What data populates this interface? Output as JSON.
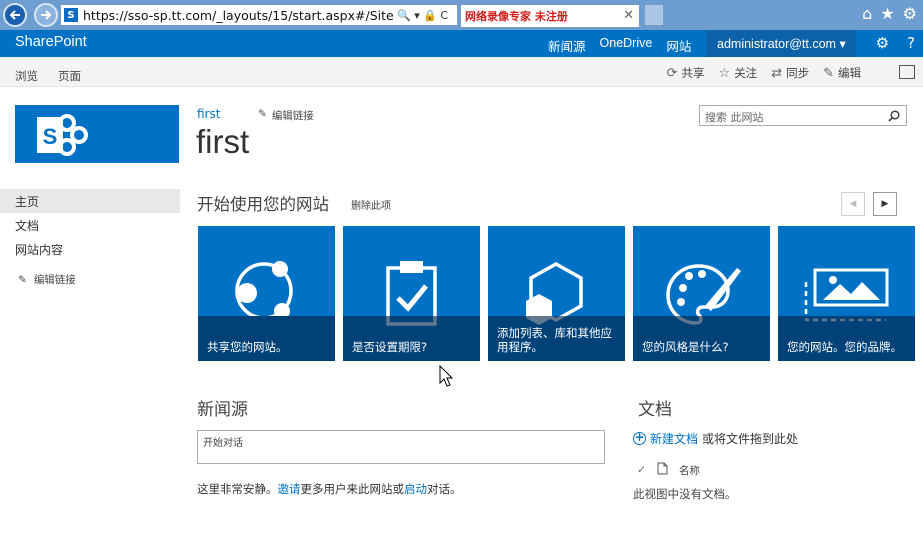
{
  "browser": {
    "address": "https://sso-sp.tt.com/_layouts/15/start.aspx#/SitePages/%E",
    "address_icons": "🔍 ▾ 🔒 C",
    "tab_watermark": "网络录像专家  未注册",
    "tab_close": "✕",
    "sp_favicon": "S"
  },
  "suite": {
    "brand": "SharePoint",
    "links": [
      "新闻源",
      "OneDrive",
      "网站"
    ],
    "user": "administrator@tt.com ▾",
    "settings_icon": "⚙",
    "help_icon": "?"
  },
  "ribbon": {
    "tabs": [
      "浏览",
      "页面"
    ],
    "actions": [
      {
        "icon": "share-icon",
        "label": "共享"
      },
      {
        "icon": "star-icon",
        "label": "关注"
      },
      {
        "icon": "sync-icon",
        "label": "同步"
      },
      {
        "icon": "edit-icon",
        "label": "编辑"
      }
    ]
  },
  "header": {
    "site_link": "first",
    "edit_links": "编辑链接",
    "title": "first",
    "search_placeholder": "搜索 此网站"
  },
  "left_nav": {
    "items": [
      "主页",
      "文档",
      "网站内容"
    ],
    "active": "主页",
    "edit_links": "编辑链接"
  },
  "get_started": {
    "title": "开始使用您的网站",
    "remove": "删除此项",
    "tiles": [
      {
        "caption": "共享您的网站。",
        "icon": "share-icon"
      },
      {
        "caption": "是否设置期限?",
        "icon": "clipboard-check-icon"
      },
      {
        "caption": "添加列表、库和其他应用程序。",
        "icon": "app-hexagon-icon"
      },
      {
        "caption": "您的风格是什么?",
        "icon": "palette-icon"
      },
      {
        "caption": "您的网站。您的品牌。",
        "icon": "picture-icon"
      }
    ]
  },
  "newsfeed": {
    "title": "新闻源",
    "placeholder": "开始对话",
    "msg_before": "这里非常安静。",
    "invite_link": "邀请",
    "msg_middle": "更多用户来此网站或",
    "start_link": "启动",
    "msg_after": "对话。"
  },
  "documents": {
    "title": "文档",
    "new_doc": "新建文档",
    "drag_text": "或将文件拖到此处",
    "col_name": "名称",
    "empty": "此视图中没有文档。"
  },
  "colors": {
    "suite_blue": "#0072c6",
    "tile_blue": "#0072c6",
    "watermark_red": "#d41b1b"
  }
}
